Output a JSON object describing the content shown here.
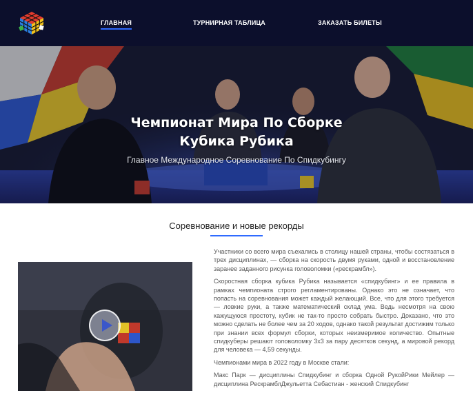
{
  "header": {
    "logo": "rubiks-cube-logo",
    "nav": [
      {
        "label": "ГЛАВНАЯ",
        "active": true
      },
      {
        "label": "ТУРНИРНАЯ ТАБЛИЦА",
        "active": false
      },
      {
        "label": "ЗАКАЗАТЬ БИЛЕТЫ",
        "active": false
      }
    ]
  },
  "hero": {
    "title_line1": "Чемпионат Мира По Сборке",
    "title_line2": "Кубика Рубика",
    "subtitle": "Главное Международное Соревнование По Спидкубингу"
  },
  "section": {
    "title": "Соревнование и новые рекорды"
  },
  "video": {
    "icon": "play-icon"
  },
  "article": {
    "p1": "Участники со всего мира съехались в столицу нашей страны, чтобы состязаться в трех дисциплинах, — сборка на скорость двумя руками, одной и восстановление заранее заданного рисунка головоломки («рескрамбл»).",
    "p2": "Скоростная сборка кубика Рубика называется «спидкубинг» и ее правила в рамках чемпионата строго регламентированы. Однако это не означает, что попасть на соревнования может каждый желающий. Все, что для этого требуется — ловкие руки, а также математический склад ума. Ведь несмотря на свою кажущуюся простоту, кубик не так-то просто собрать быстро. Доказано, что это можно сделать не более чем за 20 ходов, однако такой результат достижим только при знании всех формул сборки, которых неизмеримое количество. Опытные спидкуберы решают головоломку 3х3 за пару десятков секунд, а мировой рекорд для человека — 4,59 секунды.",
    "p3": "Чемпионами мира в 2022 году в Москве стали:",
    "p4": "Макс Парк — дисциплины Спидкубинг и сборка Одной РукойРики Мейлер — дисциплина РескрамблДжульетта Себастиан - женский Спидкубинг"
  },
  "colors": {
    "header_bg": "#0c0f2c",
    "accent": "#2f6bff"
  }
}
